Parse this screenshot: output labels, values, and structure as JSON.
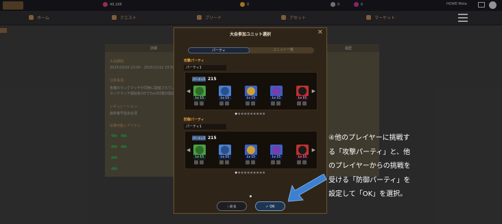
{
  "topbar": {
    "resources": [
      {
        "value": "49,188",
        "color": "#d04070"
      },
      {
        "value": "0",
        "color": "#e0a030"
      },
      {
        "value": "0",
        "color": "#9aa0a8"
      },
      {
        "value": "0",
        "color": "#c03090"
      }
    ],
    "user_label": "HOWE Meta"
  },
  "nav": {
    "items": [
      {
        "label": "ホーム",
        "icon": "home-icon"
      },
      {
        "label": "クエスト",
        "icon": "cart-icon"
      },
      {
        "label": "ブリード",
        "icon": "breed-icon"
      },
      {
        "label": "アセット",
        "icon": "asset-icon"
      },
      {
        "label": "マーケット",
        "icon": "market-icon"
      }
    ]
  },
  "background": {
    "tabs": [
      "詳細",
      "",
      "履歴"
    ],
    "lines": [
      {
        "text": "大会期間:",
        "accent": true
      },
      {
        "text": "2025/10/16 13:00 - 2025/11/12 23:59",
        "accent": false
      },
      {
        "text": "注意事項:",
        "accent": true
      },
      {
        "text": "各種のランクマッチが同時に開催されています",
        "accent": false
      },
      {
        "text": "ランクマッチ開始後3日で3vs3対戦が開放されます",
        "accent": false
      },
      {
        "text": "レギュレーション:",
        "accent": true
      },
      {
        "text": "最終番号指定必須",
        "accent": false
      },
      {
        "text": "出場可能レアリティ:",
        "accent": true
      }
    ]
  },
  "modal": {
    "title": "大会参加ユニット選択",
    "close_icon": "close-icon",
    "tabs": {
      "active": "パーティ",
      "inactive": "ユニット一覧"
    },
    "attack": {
      "section_label": "攻撃パーティ",
      "party_name": "パーティ1",
      "leader_tag": "パーティ1",
      "power": "215",
      "units": [
        {
          "level": "Lv 15",
          "color": "#4aa040"
        },
        {
          "level": "Lv 15",
          "color": "#4a80d0"
        },
        {
          "level": "Lv 15",
          "color": "#3a60c0"
        },
        {
          "level": "Lv 15",
          "color": "#3a60c0"
        },
        {
          "level": "Lv 15",
          "color": "#c03030"
        }
      ]
    },
    "defense": {
      "section_label": "防御パーティ",
      "party_name": "パーティ1",
      "leader_tag": "パーティ1",
      "power": "215",
      "units": [
        {
          "level": "Lv 15",
          "color": "#4aa040"
        },
        {
          "level": "Lv 15",
          "color": "#4a80d0"
        },
        {
          "level": "Lv 15",
          "color": "#3a60c0"
        },
        {
          "level": "Lv 15",
          "color": "#3a60c0"
        },
        {
          "level": "Lv 15",
          "color": "#c03030"
        }
      ]
    },
    "back_label": "‹ 戻る",
    "ok_label": "✓ OK"
  },
  "annotation": {
    "lines": [
      "④他のプレイヤーに挑戦す",
      "る「攻撃パーティ」と、他",
      "のプレイヤーからの挑戦を",
      "受ける「防御パーティ」を",
      "設定して「OK」を選択。"
    ],
    "arrow_color": "#3d7fd0"
  }
}
